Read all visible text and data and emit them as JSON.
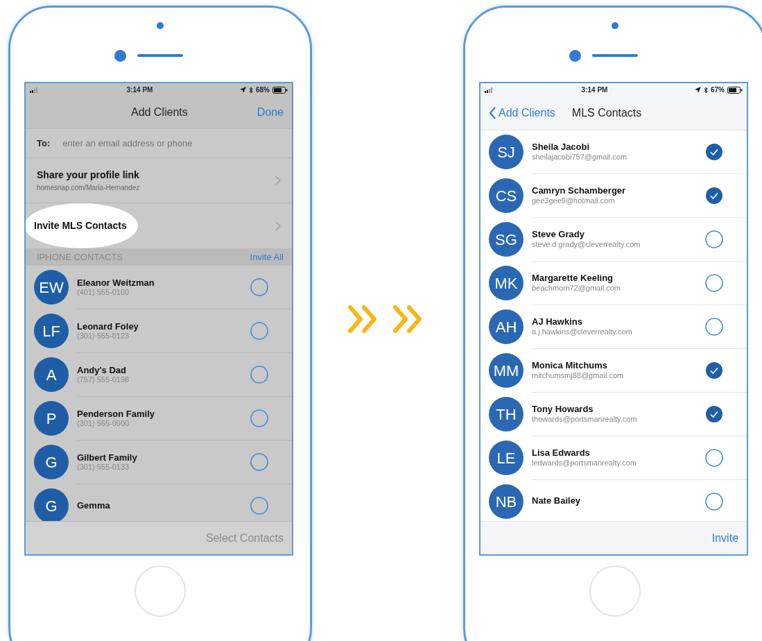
{
  "phones": [
    {
      "dimmed": true,
      "status_bar": {
        "time": "3:14 PM",
        "battery": "68%"
      },
      "nav": {
        "title": "Add Clients",
        "action": "Done"
      },
      "to_field": {
        "label": "To:",
        "placeholder": "enter an email address or phone"
      },
      "menu_items": [
        {
          "title": "Share your profile link",
          "subtitle": "homesnap.com/Maria-Hernandez",
          "highlighted": false
        },
        {
          "title": "Invite MLS Contacts",
          "highlighted": true
        }
      ],
      "section": {
        "title": "IPHONE CONTACTS",
        "action": "Invite All"
      },
      "contacts": [
        {
          "initials": "EW",
          "name": "Eleanor Weitzman",
          "detail": "(401) 555-0100",
          "checked": false
        },
        {
          "initials": "LF",
          "name": "Leonard Foley",
          "detail": "(301) 555-0123",
          "checked": false
        },
        {
          "initials": "A",
          "name": "Andy's Dad",
          "detail": "(757) 555-0198",
          "checked": false
        },
        {
          "initials": "P",
          "name": "Penderson Family",
          "detail": "(301) 555-0000",
          "checked": false
        },
        {
          "initials": "G",
          "name": "Gilbert Family",
          "detail": "(301) 555-0133",
          "checked": false
        },
        {
          "initials": "G",
          "name": "Gemma",
          "checked": false
        }
      ],
      "footer": {
        "label": "Select Contacts",
        "disabled": true
      }
    },
    {
      "dimmed": false,
      "status_bar": {
        "time": "3:14 PM",
        "battery": "67%"
      },
      "nav": {
        "back": "Add Clients",
        "title": "MLS Contacts"
      },
      "contacts": [
        {
          "initials": "SJ",
          "name": "Sheila Jacobi",
          "detail": "sheilajacobi757@gmail.com",
          "checked": true
        },
        {
          "initials": "CS",
          "name": "Camryn Schamberger",
          "detail": "gee3gee9@hotmail.com",
          "checked": true
        },
        {
          "initials": "SG",
          "name": "Steve Grady",
          "detail": "steve.d.grady@cleverrealty.com",
          "checked": false
        },
        {
          "initials": "MK",
          "name": "Margarette Keeling",
          "detail": "beachmom72@gmail.com",
          "checked": false
        },
        {
          "initials": "AH",
          "name": "AJ Hawkins",
          "detail": "a.j.hawkins@cleverrealty.com",
          "checked": false
        },
        {
          "initials": "MM",
          "name": "Monica Mitchums",
          "detail": "mitchumsmj88@gmail.com",
          "checked": true
        },
        {
          "initials": "TH",
          "name": "Tony Howards",
          "detail": "thowards@portsmanrealty.com",
          "checked": true
        },
        {
          "initials": "LE",
          "name": "Lisa Edwards",
          "detail": "ledwards@portsmanrealty.com",
          "checked": false
        },
        {
          "initials": "NB",
          "name": "Nate Bailey",
          "checked": false
        }
      ],
      "footer": {
        "label": "Invite",
        "disabled": false
      }
    }
  ]
}
